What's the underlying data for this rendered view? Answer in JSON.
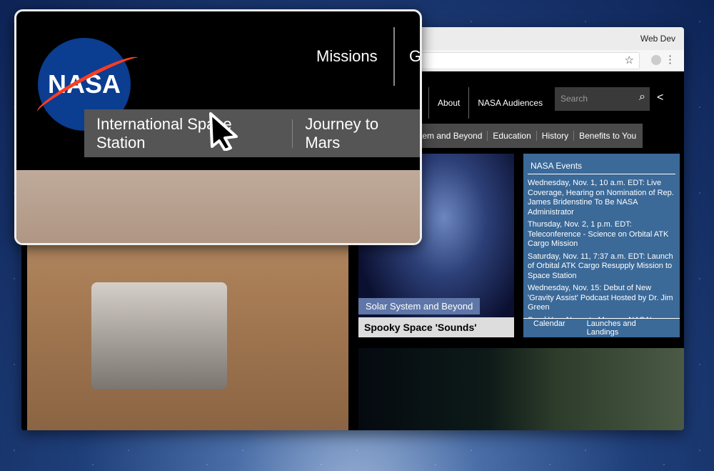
{
  "browser": {
    "profile": "Web Dev",
    "search_placeholder": "Search"
  },
  "nav": {
    "items": [
      "s",
      "About",
      "NASA Audiences"
    ]
  },
  "subnav": {
    "items": [
      "stem and Beyond",
      "Education",
      "History",
      "Benefits to You"
    ]
  },
  "feature": {
    "category": "Solar System and Beyond",
    "title": "Spooky Space 'Sounds'"
  },
  "events": {
    "heading": "NASA Events",
    "items": [
      "Wednesday, Nov. 1, 10 a.m. EDT: Live Coverage, Hearing on Nomination of Rep. James Bridenstine To Be NASA Administrator",
      "Thursday, Nov. 2, 1 p.m. EDT: Teleconference - Science on Orbital ATK Cargo Mission",
      "Saturday, Nov. 11, 7:37 a.m. EDT: Launch of Orbital ATK Cargo Resupply Mission to Space Station",
      "Wednesday, Nov. 15: Debut of New 'Gravity Assist' Podcast Hosted by Dr. Jim Green",
      "Send Your Name to Mars on NASA's"
    ],
    "links": [
      "Calendar",
      "Launches and Landings"
    ]
  },
  "magnifier": {
    "logo": "NASA",
    "nav_item": "Missions",
    "nav_cut": "G",
    "sub_items": [
      "International Space Station",
      "Journey to Mars"
    ]
  }
}
